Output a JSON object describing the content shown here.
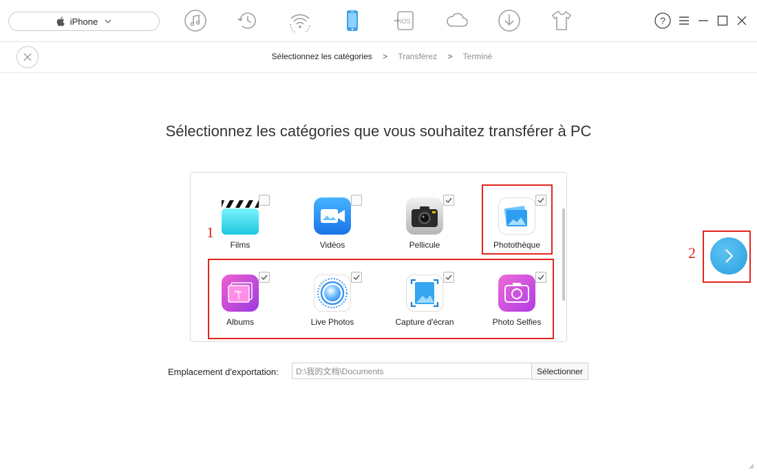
{
  "device": {
    "name": "iPhone"
  },
  "toolbar": {
    "icons": [
      "music-icon",
      "history-icon",
      "wifi-sync-icon",
      "phone-manager-icon",
      "ios-mover-icon",
      "icloud-icon",
      "download-icon",
      "tshirt-icon"
    ],
    "active_index": 3
  },
  "breadcrumb": {
    "step1": "Sélectionnez les catégories",
    "sep": ">",
    "step2": "Transférez",
    "step3": "Terminé"
  },
  "heading": "Sélectionnez les catégories que vous souhaitez transférer à PC",
  "categories": [
    {
      "label": "Films",
      "checked": false,
      "icon": "film-clapper-icon"
    },
    {
      "label": "Vidéos",
      "checked": false,
      "icon": "video-camera-icon"
    },
    {
      "label": "Pellicule",
      "checked": true,
      "icon": "camera-roll-icon"
    },
    {
      "label": "Photothèque",
      "checked": true,
      "icon": "photo-library-icon"
    },
    {
      "label": "Albums",
      "checked": true,
      "icon": "albums-icon"
    },
    {
      "label": "Live Photos",
      "checked": true,
      "icon": "live-photos-icon"
    },
    {
      "label": "Capture d'écran",
      "checked": true,
      "icon": "screenshot-icon"
    },
    {
      "label": "Photo Selfies",
      "checked": true,
      "icon": "selfie-camera-icon"
    }
  ],
  "annotations": {
    "one": "1",
    "two": "2"
  },
  "export": {
    "label": "Emplacement d'exportation:",
    "path": "D:\\我的文档\\Documents",
    "button": "Sélectionner"
  },
  "colors": {
    "accent": "#2a9fe0",
    "annotation": "#e0241b",
    "checkbox_border": "#b8b8b8"
  }
}
